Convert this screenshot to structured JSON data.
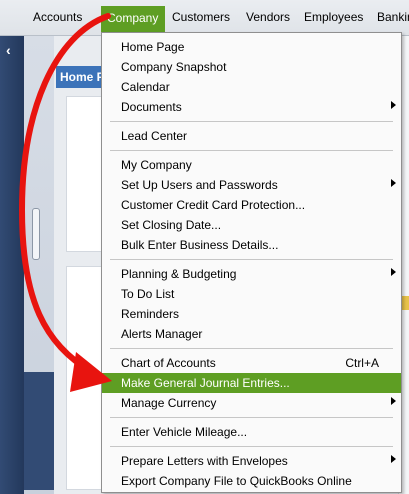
{
  "menubar": {
    "items": [
      "Accounts",
      "Company",
      "Customers",
      "Vendors",
      "Employees",
      "Banking"
    ]
  },
  "home_tab": {
    "label": "Home Page"
  },
  "company_menu": {
    "items": [
      {
        "label": "Home Page",
        "submenu": false
      },
      {
        "label": "Company Snapshot",
        "submenu": false
      },
      {
        "label": "Calendar",
        "submenu": false
      },
      {
        "label": "Documents",
        "submenu": true
      },
      {
        "label": "Lead Center",
        "submenu": false
      },
      {
        "label": "My Company",
        "submenu": false
      },
      {
        "label": "Set Up Users and Passwords",
        "submenu": true
      },
      {
        "label": "Customer Credit Card Protection...",
        "submenu": false
      },
      {
        "label": "Set Closing Date...",
        "submenu": false
      },
      {
        "label": "Bulk Enter Business Details...",
        "submenu": false
      },
      {
        "label": "Planning & Budgeting",
        "submenu": true
      },
      {
        "label": "To Do List",
        "submenu": false
      },
      {
        "label": "Reminders",
        "submenu": false
      },
      {
        "label": "Alerts Manager",
        "submenu": false
      },
      {
        "label": "Chart of Accounts",
        "shortcut": "Ctrl+A",
        "submenu": false
      },
      {
        "label": "Make General Journal Entries...",
        "submenu": false,
        "highlighted": true
      },
      {
        "label": "Manage Currency",
        "submenu": true
      },
      {
        "label": "Enter Vehicle Mileage...",
        "submenu": false
      },
      {
        "label": "Prepare Letters with Envelopes",
        "submenu": true
      },
      {
        "label": "Export Company File to QuickBooks Online",
        "submenu": false
      }
    ]
  },
  "colors": {
    "accent_green": "#5e9e23",
    "annotation_red": "#e8140f",
    "nav_blue": "#324b74"
  },
  "icons": [
    "chevron-left-icon",
    "submenu-arrow-icon",
    "annotation-arrow-icon"
  ]
}
